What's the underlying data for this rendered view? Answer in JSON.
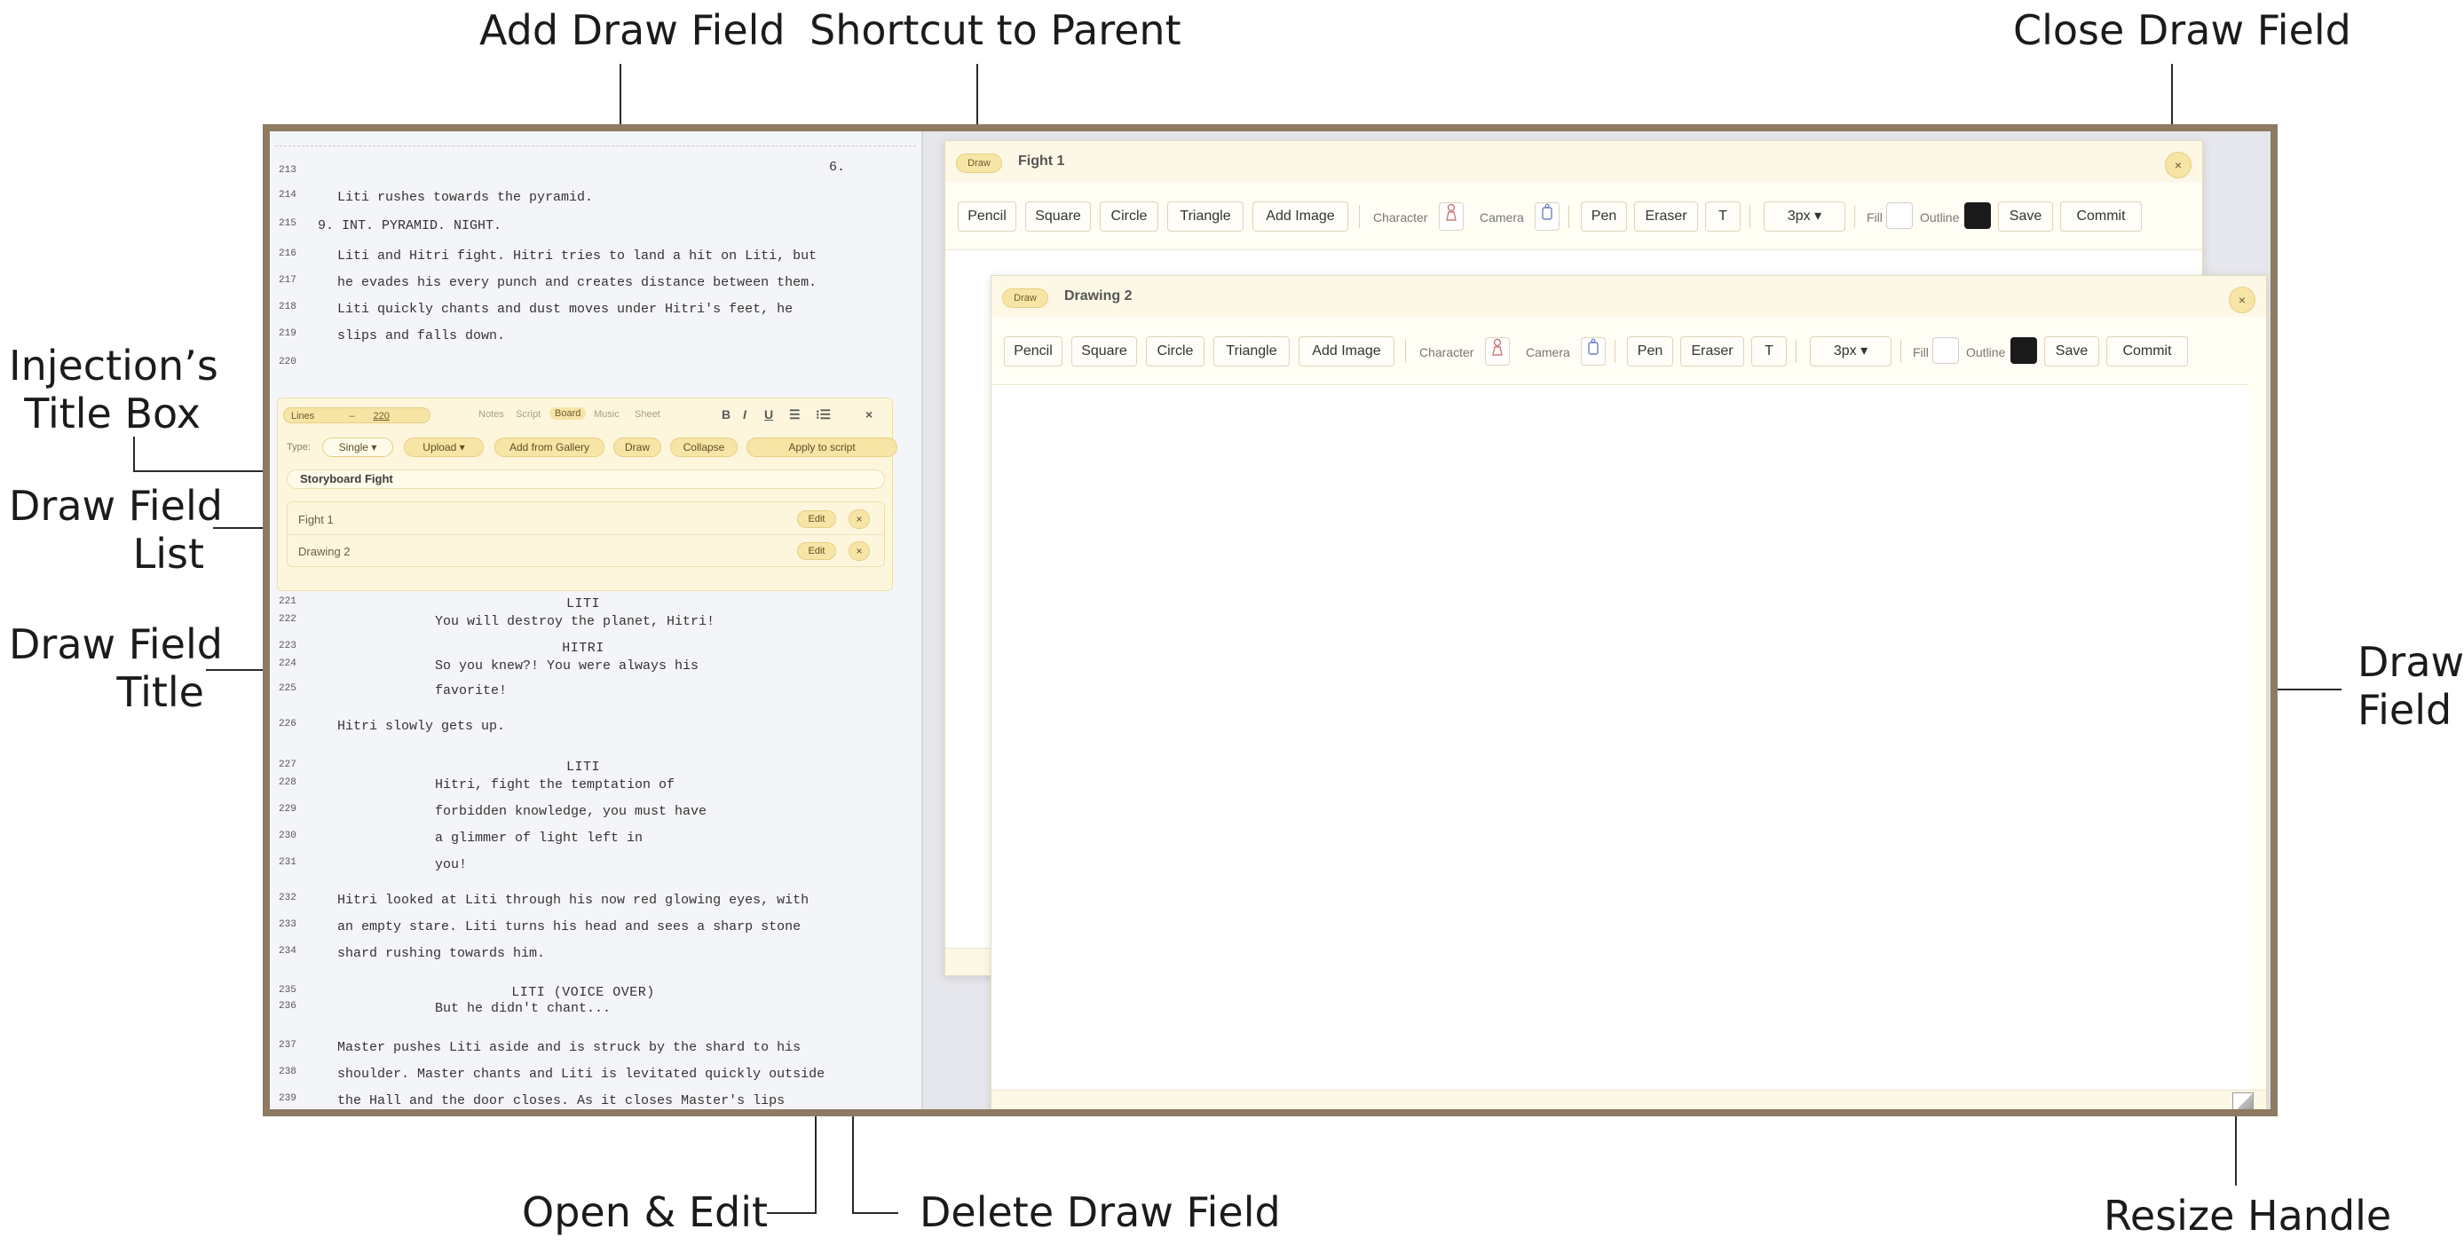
{
  "annotations": {
    "add_draw_field": "Add Draw Field",
    "shortcut_to_parent": "Shortcut to Parent",
    "close_draw_field": "Close Draw Field",
    "injection_title_box_1": "Injection’s",
    "injection_title_box_2": "Title Box",
    "draw_field_list_1": "Draw Field",
    "draw_field_list_2": "List",
    "draw_field_title_1": "Draw Field",
    "draw_field_title_2": "Title",
    "draw_field_1": "Draw",
    "draw_field_2": "Field",
    "open_edit": "Open & Edit",
    "delete_draw_field": "Delete Draw Field",
    "resize_handle": "Resize Handle"
  },
  "script_top": [
    {
      "num": "213",
      "text": ""
    },
    {
      "num": "214",
      "text": "Liti rushes towards the pyramid."
    },
    {
      "num": "215",
      "text": "9. INT. PYRAMID. NIGHT."
    },
    {
      "num": "216",
      "text": "Liti and Hitri fight. Hitri tries to land a hit on Liti, but"
    },
    {
      "num": "217",
      "text": "he evades his every punch and creates distance between them."
    },
    {
      "num": "218",
      "text": "Liti quickly chants and dust moves under Hitri's feet, he"
    },
    {
      "num": "219",
      "text": "slips and falls down."
    },
    {
      "num": "220",
      "text": ""
    }
  ],
  "page_number": "6.",
  "injection": {
    "lines_label": "Lines",
    "lines_dash": "–",
    "lines_end": "220",
    "tabs": [
      "Notes",
      "Script",
      "Board",
      "Music",
      "Sheet"
    ],
    "format": [
      "B",
      "I",
      "U",
      "☰",
      "⁝☰",
      "×"
    ],
    "type_label": "Type:",
    "type_value": "Single",
    "upload": "Upload",
    "add_gallery": "Add from Gallery",
    "draw": "Draw",
    "collapse": "Collapse",
    "apply": "Apply to script",
    "title": "Storyboard Fight",
    "drawings": [
      {
        "name": "Fight 1",
        "edit": "Edit",
        "delete": "×"
      },
      {
        "name": "Drawing 2",
        "edit": "Edit",
        "delete": "×"
      }
    ]
  },
  "script_bottom": [
    {
      "num": "221",
      "text": "LITI",
      "kind": "cue"
    },
    {
      "num": "222",
      "text": "You will destroy the planet, Hitri!",
      "kind": "dlg"
    },
    {
      "num": "223",
      "text": "HITRI",
      "kind": "cue"
    },
    {
      "num": "224",
      "text": "So you knew?! You were always his",
      "kind": "dlg"
    },
    {
      "num": "225",
      "text": "favorite!",
      "kind": "dlg"
    },
    {
      "num": "226",
      "text": "Hitri slowly gets up.",
      "kind": "act"
    },
    {
      "num": "227",
      "text": "LITI",
      "kind": "cue"
    },
    {
      "num": "228",
      "text": "Hitri, fight the temptation of",
      "kind": "dlg"
    },
    {
      "num": "229",
      "text": "forbidden knowledge, you must have",
      "kind": "dlg"
    },
    {
      "num": "230",
      "text": "a glimmer of light left in",
      "kind": "dlg"
    },
    {
      "num": "231",
      "text": "you!",
      "kind": "dlg"
    },
    {
      "num": "232",
      "text": "Hitri looked at Liti through his now red glowing eyes, with",
      "kind": "act"
    },
    {
      "num": "233",
      "text": "an empty stare. Liti turns his head and sees a sharp stone",
      "kind": "act"
    },
    {
      "num": "234",
      "text": "shard rushing towards him.",
      "kind": "act"
    },
    {
      "num": "235",
      "text": "LITI (VOICE OVER)",
      "kind": "cue"
    },
    {
      "num": "236",
      "text": "But he didn't chant...",
      "kind": "dlg"
    },
    {
      "num": "237",
      "text": "Master pushes Liti aside and is struck by the shard to his",
      "kind": "act"
    },
    {
      "num": "238",
      "text": "shoulder. Master chants and Liti is levitated quickly outside",
      "kind": "act"
    },
    {
      "num": "239",
      "text": "the Hall and the door closes. As it closes Master's lips",
      "kind": "act"
    }
  ],
  "toolbar": {
    "pencil": "Pencil",
    "square": "Square",
    "circle": "Circle",
    "triangle": "Triangle",
    "add_image": "Add Image",
    "character": "Character",
    "camera": "Camera",
    "pen": "Pen",
    "eraser": "Eraser",
    "text": "T",
    "size": "3px ▾",
    "fill": "Fill",
    "outline": "Outline",
    "save": "Save",
    "commit": "Commit"
  },
  "window_back": {
    "badge": "Draw",
    "title": "Fight 1",
    "close": "×"
  },
  "window_front": {
    "badge": "Draw",
    "title": "Drawing 2",
    "close": "×"
  },
  "colors": {
    "accent": "#f7e5a6",
    "frame": "#8e7a60",
    "outline_swatch": "#1a1a1a"
  }
}
